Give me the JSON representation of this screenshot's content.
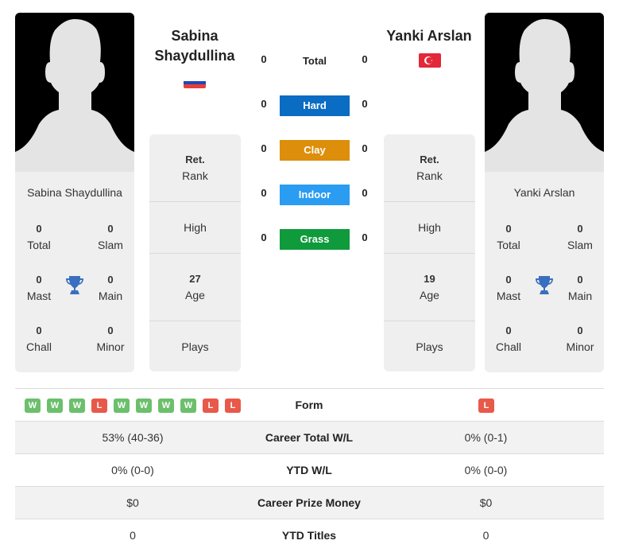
{
  "players": [
    {
      "name": "Sabina Shaydullina",
      "title_line1": "Sabina",
      "title_line2": "Shaydullina",
      "flag": "russia-flag",
      "card_name": "Sabina Shaydullina",
      "titles": {
        "total": {
          "value": "0",
          "label": "Total"
        },
        "slam": {
          "value": "0",
          "label": "Slam"
        },
        "mast": {
          "value": "0",
          "label": "Mast"
        },
        "main": {
          "value": "0",
          "label": "Main"
        },
        "chall": {
          "value": "0",
          "label": "Chall"
        },
        "minor": {
          "value": "0",
          "label": "Minor"
        }
      },
      "rank": {
        "value": "Ret.",
        "label": "Rank"
      },
      "high": {
        "value": "",
        "label": "High"
      },
      "age": {
        "value": "27",
        "label": "Age"
      },
      "plays": {
        "value": "",
        "label": "Plays"
      }
    },
    {
      "name": "Yanki Arslan",
      "title_line1": "Yanki Arslan",
      "flag": "turkey-flag",
      "card_name": "Yanki Arslan",
      "titles": {
        "total": {
          "value": "0",
          "label": "Total"
        },
        "slam": {
          "value": "0",
          "label": "Slam"
        },
        "mast": {
          "value": "0",
          "label": "Mast"
        },
        "main": {
          "value": "0",
          "label": "Main"
        },
        "chall": {
          "value": "0",
          "label": "Chall"
        },
        "minor": {
          "value": "0",
          "label": "Minor"
        }
      },
      "rank": {
        "value": "Ret.",
        "label": "Rank"
      },
      "high": {
        "value": "",
        "label": "High"
      },
      "age": {
        "value": "19",
        "label": "Age"
      },
      "plays": {
        "value": "",
        "label": "Plays"
      }
    }
  ],
  "h2h": {
    "total": {
      "label": "Total",
      "left": "0",
      "right": "0"
    },
    "surfaces": [
      {
        "label": "Hard",
        "left": "0",
        "right": "0",
        "color": "#0a6cc2"
      },
      {
        "label": "Clay",
        "left": "0",
        "right": "0",
        "color": "#dd8e0a"
      },
      {
        "label": "Indoor",
        "left": "0",
        "right": "0",
        "color": "#2a9cf2"
      },
      {
        "label": "Grass",
        "left": "0",
        "right": "0",
        "color": "#0f9a3c"
      }
    ]
  },
  "comparison": {
    "form": {
      "label": "Form",
      "left": [
        "W",
        "W",
        "W",
        "L",
        "W",
        "W",
        "W",
        "W",
        "L",
        "L"
      ],
      "right": [
        "L"
      ]
    },
    "rows": [
      {
        "label": "Career Total W/L",
        "left": "53% (40-36)",
        "right": "0% (0-1)"
      },
      {
        "label": "YTD W/L",
        "left": "0% (0-0)",
        "right": "0% (0-0)"
      },
      {
        "label": "Career Prize Money",
        "left": "$0",
        "right": "$0"
      },
      {
        "label": "YTD Titles",
        "left": "0",
        "right": "0"
      }
    ]
  },
  "colors": {
    "win": "#6cbf6c",
    "loss": "#e8594a",
    "trophy": "#3a6fbf"
  }
}
